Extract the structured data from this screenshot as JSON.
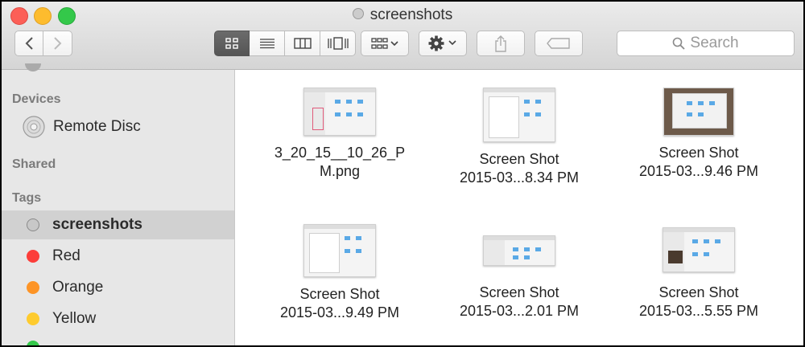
{
  "window": {
    "title": "screenshots"
  },
  "toolbar": {
    "search_placeholder": "Search"
  },
  "sidebar": {
    "sections": {
      "devices": "Devices",
      "shared": "Shared",
      "tags": "Tags"
    },
    "devices": [
      {
        "label": "Remote Disc",
        "icon": "disc-icon"
      }
    ],
    "tags": [
      {
        "label": "screenshots",
        "color": "#c8c8c8",
        "selected": true
      },
      {
        "label": "Red",
        "color": "#fc3d39"
      },
      {
        "label": "Orange",
        "color": "#fd9426"
      },
      {
        "label": "Yellow",
        "color": "#fecb2e"
      }
    ]
  },
  "files": [
    {
      "line1": "3_20_15__10_26_P",
      "line2": "M.png"
    },
    {
      "line1": "Screen Shot",
      "line2": "2015-03...8.34 PM"
    },
    {
      "line1": "Screen Shot",
      "line2": "2015-03...9.46 PM"
    },
    {
      "line1": "Screen Shot",
      "line2": "2015-03...9.49 PM"
    },
    {
      "line1": "Screen Shot",
      "line2": "2015-03...2.01 PM"
    },
    {
      "line1": "Screen Shot",
      "line2": "2015-03...5.55 PM"
    }
  ]
}
